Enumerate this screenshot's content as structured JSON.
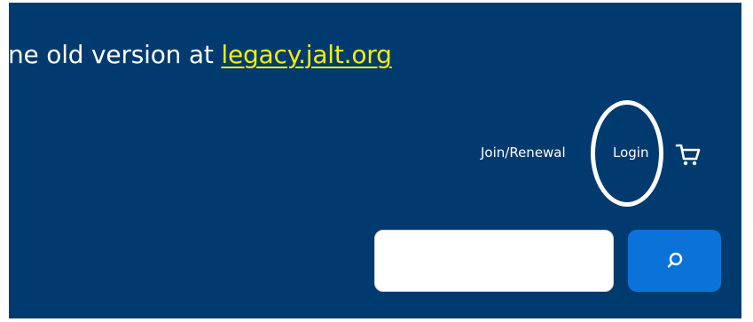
{
  "banner": {
    "prefix": "ne old version at ",
    "link": "legacy.jalt.org"
  },
  "nav": {
    "join": "Join/Renewal",
    "login": "Login"
  },
  "icons": {
    "cart": "shopping-cart-icon",
    "search": "search-icon"
  },
  "search": {
    "value": "",
    "placeholder": ""
  },
  "colors": {
    "background": "#013a6f",
    "link": "#f5f100",
    "search_button": "#0b72da",
    "annotation": "#ffffff"
  }
}
